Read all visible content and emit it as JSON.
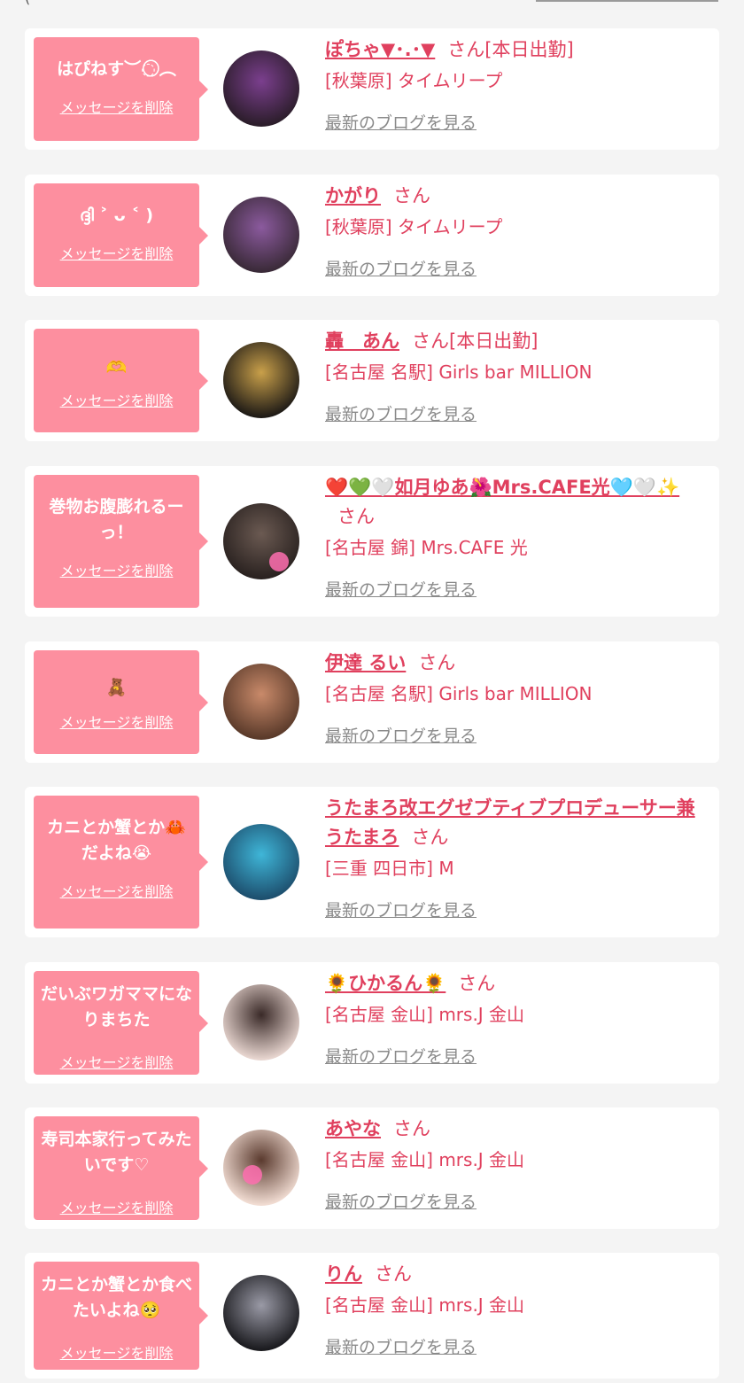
{
  "header": {
    "partial_text": "("
  },
  "cards": [
    {
      "message": "はぴねす︶⁠◌ ⃝⃝︵",
      "delete_label": "メッセージを削除",
      "name": "ぽちゃ▼･.･▼",
      "suffix": "さん[本日出勤]",
      "shop": "[秋葉原] タイムリープ",
      "blog_label": "最新のブログを見る",
      "avatar_colors": [
        "#2b1d2a",
        "#7b3f8e"
      ]
    },
    {
      "message": "ദ്ദി ˃ ᴗ ˂ )",
      "delete_label": "メッセージを削除",
      "name": "かがり",
      "suffix": "さん",
      "shop": "[秋葉原] タイムリープ",
      "blog_label": "最新のブログを見る",
      "avatar_colors": [
        "#3a2a38",
        "#8b5a9e"
      ]
    },
    {
      "message": "🫶",
      "delete_label": "メッセージを削除",
      "name": "轟　あん",
      "suffix": "さん[本日出勤]",
      "shop": "[名古屋 名駅] Girls bar MILLION",
      "blog_label": "最新のブログを見る",
      "avatar_colors": [
        "#1e1a16",
        "#c9a04a"
      ]
    },
    {
      "message": "巻物お腹膨れるーっ！",
      "delete_label": "メッセージを削除",
      "name": "❤️💚🤍如月ゆあ🌺Mrs.CAFE光🩵🤍✨",
      "suffix": "さん",
      "shop": "[名古屋 錦] Mrs.CAFE 光",
      "blog_label": "最新のブログを見る",
      "avatar_colors": [
        "#2a2220",
        "#6b5a52"
      ]
    },
    {
      "message": "🧸",
      "delete_label": "メッセージを削除",
      "name": "伊達 るい",
      "suffix": "さん",
      "shop": "[名古屋 名駅] Girls bar MILLION",
      "blog_label": "最新のブログを見る",
      "avatar_colors": [
        "#5a3a2a",
        "#c98a6a"
      ]
    },
    {
      "message": "カニとか蟹とか🦀だよね😭",
      "delete_label": "メッセージを削除",
      "name": "うたまろ改エグゼブティブプロデューサー兼うたまろ",
      "suffix": "さん",
      "shop": "[三重 四日市] M",
      "blog_label": "最新のブログを見る",
      "avatar_colors": [
        "#1d4f6e",
        "#3fb6d8"
      ]
    },
    {
      "message": "だいぶワガママになりまちた",
      "delete_label": "メッセージを削除",
      "name": "🌻ひかるん🌻",
      "suffix": "さん",
      "shop": "[名古屋 金山] mrs.J 金山",
      "blog_label": "最新のブログを見る",
      "avatar_colors": [
        "#e8d6d0",
        "#3a2a28"
      ]
    },
    {
      "message": "寿司本家行ってみたいです♡",
      "delete_label": "メッセージを削除",
      "name": "あやな",
      "suffix": "さん",
      "shop": "[名古屋 金山] mrs.J 金山",
      "blog_label": "最新のブログを見る",
      "avatar_colors": [
        "#f1dcd2",
        "#5a3a2e"
      ]
    },
    {
      "message": "カニとか蟹とか食べたいよね🥺",
      "delete_label": "メッセージを削除",
      "name": "りん",
      "suffix": "さん",
      "shop": "[名古屋 金山] mrs.J 金山",
      "blog_label": "最新のブログを見る",
      "avatar_colors": [
        "#1a1a1e",
        "#9a9aa6"
      ]
    }
  ]
}
